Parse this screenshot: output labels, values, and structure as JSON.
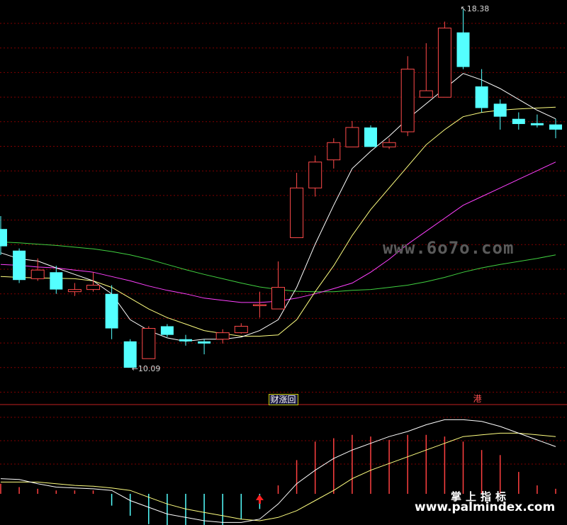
{
  "chart_data": [
    {
      "type": "candlestick",
      "panel": "price",
      "ylim": [
        9.5,
        18.6
      ],
      "grid": true,
      "colors": {
        "up": "#ff4a4a",
        "down": "#54ffff",
        "ma5": "#ffffff",
        "ma10": "#ffff80",
        "ma20": "#ff40ff",
        "ma60": "#40d040",
        "background": "#000000",
        "grid": "#800000"
      },
      "candles": [
        {
          "o": 13.3,
          "c": 12.9,
          "h": 13.6,
          "l": 12.7
        },
        {
          "o": 12.8,
          "c": 12.12,
          "h": 12.85,
          "l": 12.05
        },
        {
          "o": 12.15,
          "c": 12.35,
          "h": 12.62,
          "l": 12.1
        },
        {
          "o": 12.3,
          "c": 11.9,
          "h": 12.45,
          "l": 11.8
        },
        {
          "o": 11.85,
          "c": 11.9,
          "h": 12.05,
          "l": 11.75
        },
        {
          "o": 11.9,
          "c": 12.0,
          "h": 12.3,
          "l": 11.85
        },
        {
          "o": 11.8,
          "c": 11.0,
          "h": 12.0,
          "l": 10.75
        },
        {
          "o": 10.7,
          "c": 10.09,
          "h": 10.75,
          "l": 10.09
        },
        {
          "o": 10.3,
          "c": 11.0,
          "h": 11.05,
          "l": 10.3
        },
        {
          "o": 11.05,
          "c": 10.85,
          "h": 11.1,
          "l": 10.8
        },
        {
          "o": 10.75,
          "c": 10.7,
          "h": 10.85,
          "l": 10.6
        },
        {
          "o": 10.7,
          "c": 10.65,
          "h": 10.75,
          "l": 10.4
        },
        {
          "o": 10.75,
          "c": 10.9,
          "h": 10.98,
          "l": 10.65
        },
        {
          "o": 10.9,
          "c": 11.05,
          "h": 11.12,
          "l": 10.88
        },
        {
          "o": 11.55,
          "c": 11.55,
          "h": 11.85,
          "l": 11.25
        },
        {
          "o": 11.45,
          "c": 11.95,
          "h": 12.55,
          "l": 11.45
        },
        {
          "o": 13.1,
          "c": 14.25,
          "h": 14.6,
          "l": 13.1
        },
        {
          "o": 14.25,
          "c": 14.85,
          "h": 15.0,
          "l": 14.05
        },
        {
          "o": 14.9,
          "c": 15.3,
          "h": 15.4,
          "l": 14.7
        },
        {
          "o": 15.2,
          "c": 15.65,
          "h": 15.8,
          "l": 15.2
        },
        {
          "o": 15.65,
          "c": 15.2,
          "h": 15.7,
          "l": 15.2
        },
        {
          "o": 15.2,
          "c": 15.3,
          "h": 15.4,
          "l": 15.15
        },
        {
          "o": 15.55,
          "c": 17.0,
          "h": 17.3,
          "l": 15.45
        },
        {
          "o": 16.35,
          "c": 16.5,
          "h": 17.6,
          "l": 16.35
        },
        {
          "o": 16.35,
          "c": 17.95,
          "h": 18.1,
          "l": 16.35
        },
        {
          "o": 17.85,
          "c": 17.05,
          "h": 18.38,
          "l": 17.0
        },
        {
          "o": 16.6,
          "c": 16.1,
          "h": 17.0,
          "l": 16.0
        },
        {
          "o": 16.2,
          "c": 15.9,
          "h": 16.3,
          "l": 15.6
        },
        {
          "o": 15.85,
          "c": 15.73,
          "h": 16.0,
          "l": 15.6
        },
        {
          "o": 15.75,
          "c": 15.7,
          "h": 15.95,
          "l": 15.65
        },
        {
          "o": 15.72,
          "c": 15.6,
          "h": 15.85,
          "l": 15.4
        }
      ],
      "ma5": [
        12.75,
        12.61,
        12.56,
        12.4,
        12.25,
        12.1,
        11.8,
        11.2,
        10.95,
        10.78,
        10.7,
        10.75,
        10.75,
        10.8,
        10.95,
        11.2,
        11.95,
        12.95,
        13.85,
        14.7,
        15.1,
        15.45,
        15.85,
        16.2,
        16.55,
        16.9,
        16.75,
        16.55,
        16.3,
        16.05,
        15.85
      ],
      "ma10": [
        12.2,
        12.18,
        12.17,
        12.16,
        12.15,
        12.1,
        11.95,
        11.7,
        11.45,
        11.25,
        11.1,
        10.95,
        10.88,
        10.82,
        10.82,
        10.85,
        11.2,
        11.85,
        12.45,
        13.15,
        13.75,
        14.25,
        14.75,
        15.25,
        15.6,
        15.9,
        16.0,
        16.05,
        16.08,
        16.1,
        16.12
      ],
      "ma20": [
        12.48,
        12.46,
        12.42,
        12.4,
        12.35,
        12.3,
        12.2,
        12.1,
        11.98,
        11.88,
        11.8,
        11.7,
        11.65,
        11.6,
        11.6,
        11.63,
        11.7,
        11.8,
        11.92,
        12.05,
        12.3,
        12.6,
        12.95,
        13.25,
        13.55,
        13.85,
        14.05,
        14.25,
        14.45,
        14.65,
        14.85
      ],
      "ma60": [
        13.0,
        12.98,
        12.95,
        12.92,
        12.88,
        12.84,
        12.78,
        12.7,
        12.6,
        12.48,
        12.36,
        12.25,
        12.15,
        12.05,
        11.96,
        11.9,
        11.86,
        11.85,
        11.85,
        11.88,
        11.9,
        11.95,
        12.0,
        12.08,
        12.18,
        12.3,
        12.4,
        12.48,
        12.55,
        12.62,
        12.7
      ],
      "annotations": {
        "high_label": "18.38",
        "low_label": "10.09"
      }
    },
    {
      "type": "bar-line",
      "panel": "indicator",
      "ylim": [
        -3.2,
        4.5
      ],
      "bars": [
        0.6,
        0.4,
        0.3,
        0.2,
        0.2,
        0.2,
        -0.7,
        -1.3,
        -1.8,
        -1.9,
        -2.0,
        -2.1,
        -2.2,
        -1.5,
        -0.9,
        0.5,
        2.0,
        3.1,
        3.3,
        3.5,
        3.4,
        3.2,
        3.5,
        3.5,
        3.4,
        3.1,
        2.6,
        2.3,
        1.3,
        0.5,
        0.3
      ],
      "line1": [
        0.9,
        0.85,
        0.6,
        0.4,
        0.35,
        0.3,
        0.2,
        -0.4,
        -0.8,
        -1.2,
        -1.4,
        -1.6,
        -1.7,
        -1.7,
        -1.5,
        -0.6,
        0.6,
        1.4,
        2.1,
        2.6,
        3.0,
        3.4,
        3.7,
        4.1,
        4.4,
        4.4,
        4.3,
        4.0,
        3.6,
        3.2,
        2.8
      ],
      "line2": [
        0.7,
        0.7,
        0.7,
        0.6,
        0.5,
        0.45,
        0.35,
        0.2,
        -0.2,
        -0.6,
        -0.9,
        -1.1,
        -1.3,
        -1.5,
        -1.6,
        -1.4,
        -1.0,
        -0.4,
        0.2,
        0.9,
        1.4,
        1.8,
        2.2,
        2.6,
        3.0,
        3.4,
        3.5,
        3.6,
        3.6,
        3.5,
        3.4
      ],
      "colors": {
        "positive": "#ff4040",
        "negative": "#54ffff",
        "line1": "#ffffff",
        "line2": "#ffff80"
      }
    }
  ],
  "signal_tags": [
    {
      "text": "财涨回",
      "index": 15
    },
    {
      "text": "港",
      "index": 26
    }
  ],
  "watermarks": {
    "line1": "www.6o7o.com",
    "line2": "掌上指标",
    "line3": "www.palmindex.com"
  }
}
